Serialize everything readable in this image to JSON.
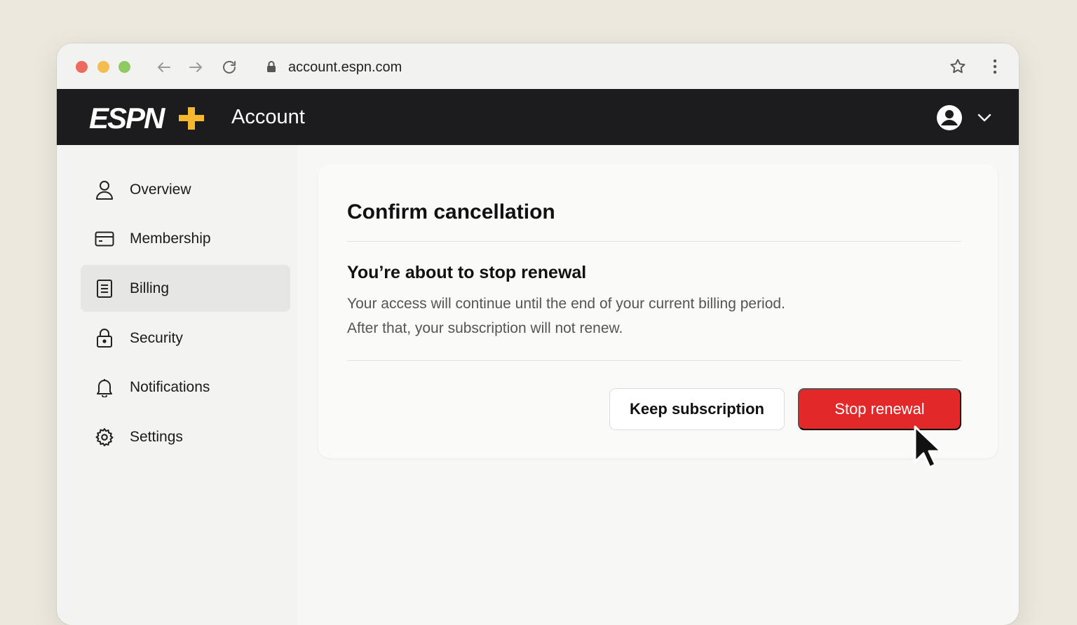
{
  "browser": {
    "url": "account.espn.com",
    "icons": [
      "back-arrow-icon",
      "forward-arrow-icon",
      "reload-icon",
      "lock-icon",
      "star-icon",
      "more-vertical-icon"
    ]
  },
  "header": {
    "logo_text": "ESPN+",
    "title": "Account",
    "colors": {
      "background": "#1c1c1e",
      "logo_plus": "#f5b82e"
    }
  },
  "sidebar": {
    "items": [
      {
        "label": "Overview",
        "icon": "user-icon",
        "active": false
      },
      {
        "label": "Membership",
        "icon": "card-icon",
        "active": false
      },
      {
        "label": "Billing",
        "icon": "receipt-icon",
        "active": true
      },
      {
        "label": "Security",
        "icon": "lock-icon",
        "active": false
      },
      {
        "label": "Notifications",
        "icon": "bell-icon",
        "active": false
      },
      {
        "label": "Settings",
        "icon": "gear-icon",
        "active": false
      }
    ]
  },
  "dialog": {
    "title": "Confirm cancellation",
    "subtitle": "You’re about to stop renewal",
    "body_line_1": "Your access will continue until the end of your current billing period.",
    "body_line_2": "After that, your subscription will not renew.",
    "keep_label": "Keep subscription",
    "stop_label": "Stop renewal",
    "colors": {
      "stop_button": "#e3282a"
    }
  }
}
